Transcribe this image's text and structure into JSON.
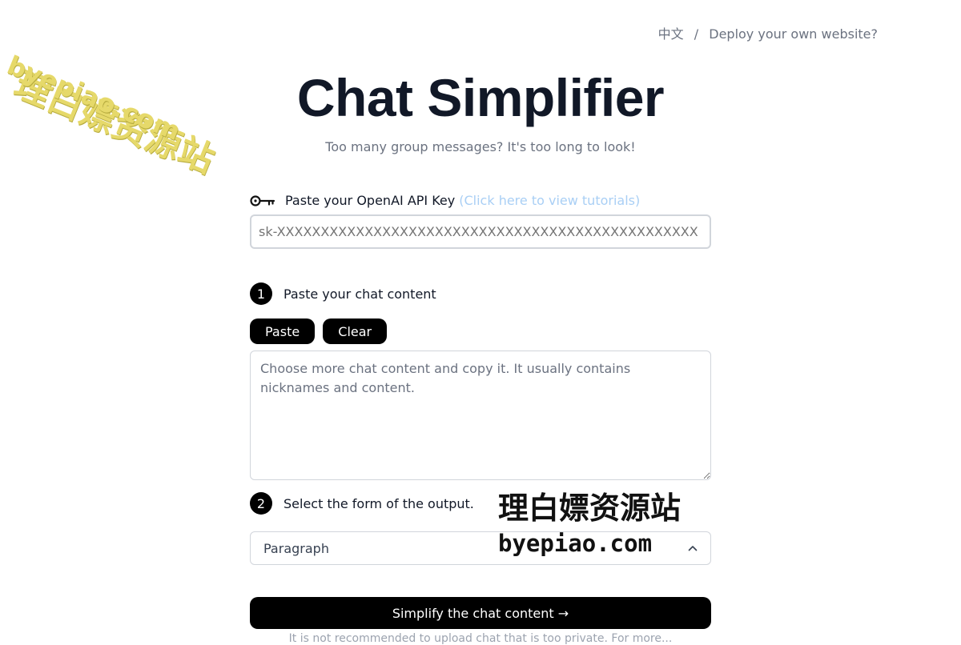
{
  "nav": {
    "lang": "中文",
    "separator": "/",
    "deploy": "Deploy your own website?"
  },
  "header": {
    "title": "Chat Simplifier",
    "subtitle": "Too many group messages? It's too long to look!"
  },
  "api_key": {
    "label": "Paste your OpenAI API Key",
    "tutorial_link": "(Click here to view tutorials)",
    "placeholder": "sk-XXXXXXXXXXXXXXXXXXXXXXXXXXXXXXXXXXXXXXXXXXXXXXXX"
  },
  "step1": {
    "number": "1",
    "label": "Paste your chat content",
    "paste_label": "Paste",
    "clear_label": "Clear",
    "placeholder": "Choose more chat content and copy it. It usually contains nicknames and content."
  },
  "step2": {
    "number": "2",
    "label": "Select the form of the output.",
    "selected": "Paragraph"
  },
  "submit": {
    "label": "Simplify the chat content →"
  },
  "footnote": "It is not recommended to upload chat that is too private. For more...",
  "watermarks": {
    "top_left_cn": "理白嫖资源站",
    "top_left_en": "byepiao.com",
    "center_cn": "理白嫖资源站",
    "center_en": "byepiao.com"
  },
  "colors": {
    "accent": "#000000",
    "link": "#a9cff5",
    "muted_text": "#6b7280",
    "watermark_yellow": "#e6d96a"
  },
  "icons": {
    "key": "key-icon",
    "select_chevron": "chevron-up-icon"
  }
}
